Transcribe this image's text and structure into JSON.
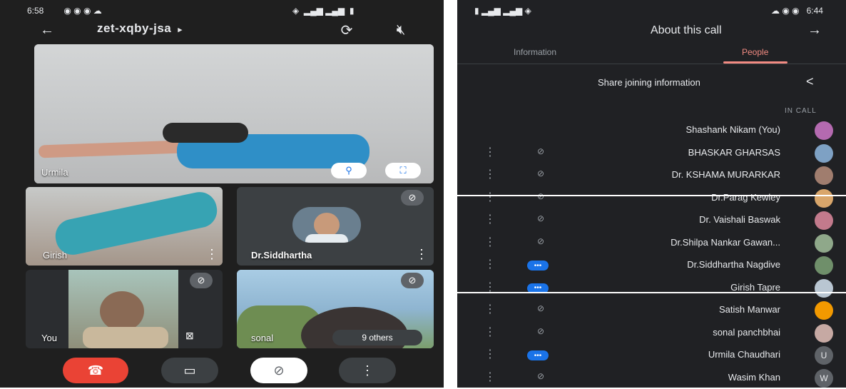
{
  "left_status": {
    "time": "6:58",
    "icons": [
      "wifi-icon",
      "signal-icon",
      "signal-icon",
      "battery-icon"
    ]
  },
  "meeting": {
    "code": "zet-xqby-jsa",
    "caret": "▸"
  },
  "tiles": [
    {
      "name": "Urmila"
    },
    {
      "name": "Girish"
    },
    {
      "name": "Dr.Siddhartha"
    },
    {
      "name": "You"
    },
    {
      "name": "sonal"
    }
  ],
  "others_label": "9 others",
  "right_status": {
    "time": "6:44"
  },
  "panel": {
    "title": "About this call",
    "tabs": [
      {
        "label": "People",
        "active": true
      },
      {
        "label": "Information",
        "active": false
      }
    ],
    "share_label": "Share joining information",
    "section_label": "IN CALL"
  },
  "people": [
    {
      "name": "Shashank Nikam (You)",
      "color": "#b46ab0",
      "state": "none"
    },
    {
      "name": "BHASKAR GHARSAS",
      "color": "#7ea1c4",
      "state": "muted"
    },
    {
      "name": "Dr. KSHAMA MURARKAR",
      "color": "#a07d6e",
      "state": "muted"
    },
    {
      "name": "Dr.Parag Kewley",
      "color": "#d9a66b",
      "state": "muted"
    },
    {
      "name": "Dr. Vaishali Baswak",
      "color": "#c27a8c",
      "state": "muted"
    },
    {
      "name": "Dr.Shilpa Nankar Gawan...",
      "color": "#8fa88a",
      "state": "muted"
    },
    {
      "name": "Dr.Siddhartha Nagdive",
      "color": "#6f8f6a",
      "state": "speaking"
    },
    {
      "name": "Girish Tapre",
      "color": "#b9c6d2",
      "state": "speaking"
    },
    {
      "name": "Satish Manwar",
      "color": "#f29900",
      "state": "muted"
    },
    {
      "name": "sonal panchbhai",
      "color": "#c6a9a3",
      "state": "muted"
    },
    {
      "name": "Urmila Chaudhari",
      "color": "#5f6368",
      "state": "speaking",
      "initial": "U"
    },
    {
      "name": "Wasim Khan",
      "color": "#5f6368",
      "state": "muted",
      "initial": "W"
    }
  ],
  "colors": {
    "end_call": "#ea4335",
    "active_tab": "#f28b82",
    "accent": "#1a73e8"
  }
}
